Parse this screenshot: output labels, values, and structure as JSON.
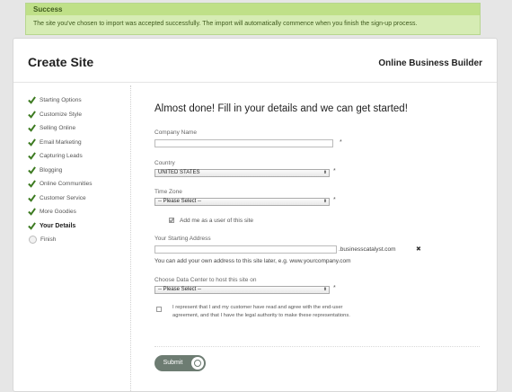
{
  "banner": {
    "title": "Success",
    "message": "The site you've chosen to import was accepted successfully. The import will automatically commence when you finish the sign-up process."
  },
  "header": {
    "title": "Create Site",
    "brand": "Online Business Builder"
  },
  "steps": [
    {
      "label": "Starting Options",
      "state": "done"
    },
    {
      "label": "Customize Style",
      "state": "done"
    },
    {
      "label": "Selling Online",
      "state": "done"
    },
    {
      "label": "Email Marketing",
      "state": "done"
    },
    {
      "label": "Capturing Leads",
      "state": "done"
    },
    {
      "label": "Blogging",
      "state": "done"
    },
    {
      "label": "Online Communities",
      "state": "done"
    },
    {
      "label": "Customer Service",
      "state": "done"
    },
    {
      "label": "More Goodies",
      "state": "done"
    },
    {
      "label": "Your Details",
      "state": "current"
    },
    {
      "label": "Finish",
      "state": "pending"
    }
  ],
  "form": {
    "headline": "Almost done! Fill in your details and we can get started!",
    "company_label": "Company Name",
    "company_value": "",
    "country_label": "Country",
    "country_value": "UNITED STATES",
    "timezone_label": "Time Zone",
    "timezone_value": "-- Please Select --",
    "add_user_label": "Add me as a user of this site",
    "address_label": "Your Starting Address",
    "address_value": "",
    "address_suffix": ".businesscatalyst.com",
    "address_hint": "You can add your own address to this site later, e.g. www.yourcompany.com",
    "datacenter_label": "Choose Data Center to host this site on",
    "datacenter_value": "-- Please Select --",
    "terms_text": "I represent that I and my customer have read and agree with the end-user agreement, and that I have the legal authority to make these representations.",
    "required_mark": "*",
    "submit_label": "Submit"
  },
  "colors": {
    "success_bg": "#d6ecb4",
    "check_green": "#3c7a20",
    "submit_bg": "#6d7c72"
  }
}
